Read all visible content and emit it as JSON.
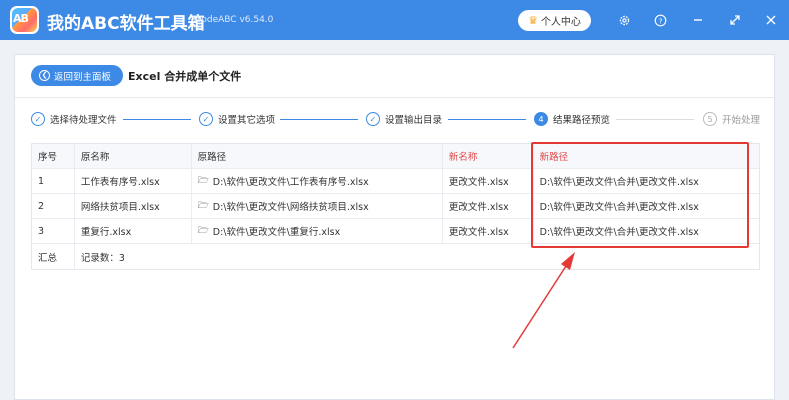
{
  "app": {
    "title": "我的ABC软件工具箱",
    "version": "WodeABC v6.54.0",
    "logo_text": "AB",
    "user_center": "个人中心",
    "icons": [
      "gear-icon",
      "help-icon",
      "minimize-icon",
      "maximize-icon",
      "close-icon"
    ],
    "accent_color": "#3d8ae6"
  },
  "page": {
    "back_label": "返回到主面板",
    "title": "Excel 合并成单个文件"
  },
  "steps": [
    {
      "label": "选择待处理文件",
      "marker": "✓",
      "state": "done"
    },
    {
      "label": "设置其它选项",
      "marker": "✓",
      "state": "done"
    },
    {
      "label": "设置输出目录",
      "marker": "✓",
      "state": "done"
    },
    {
      "label": "结果路径预览",
      "marker": "4",
      "state": "active"
    },
    {
      "label": "开始处理",
      "marker": "5",
      "state": "pending"
    }
  ],
  "table": {
    "headers": [
      "序号",
      "原名称",
      "原路径",
      "新名称",
      "新路径"
    ],
    "highlight_color": "#e24b4b",
    "rows": [
      {
        "index": "1",
        "old_name": "工作表有序号.xlsx",
        "old_path": "D:\\软件\\更改文件\\工作表有序号.xlsx",
        "new_name": "更改文件.xlsx",
        "new_path": "D:\\软件\\更改文件\\合并\\更改文件.xlsx"
      },
      {
        "index": "2",
        "old_name": "网络扶贫项目.xlsx",
        "old_path": "D:\\软件\\更改文件\\网络扶贫项目.xlsx",
        "new_name": "更改文件.xlsx",
        "new_path": "D:\\软件\\更改文件\\合并\\更改文件.xlsx"
      },
      {
        "index": "3",
        "old_name": "重复行.xlsx",
        "old_path": "D:\\软件\\更改文件\\重复行.xlsx",
        "new_name": "更改文件.xlsx",
        "new_path": "D:\\软件\\更改文件\\合并\\更改文件.xlsx"
      }
    ],
    "summary_label": "汇总",
    "summary_text": "记录数：3"
  },
  "annotation": {
    "color": "#e53935"
  }
}
